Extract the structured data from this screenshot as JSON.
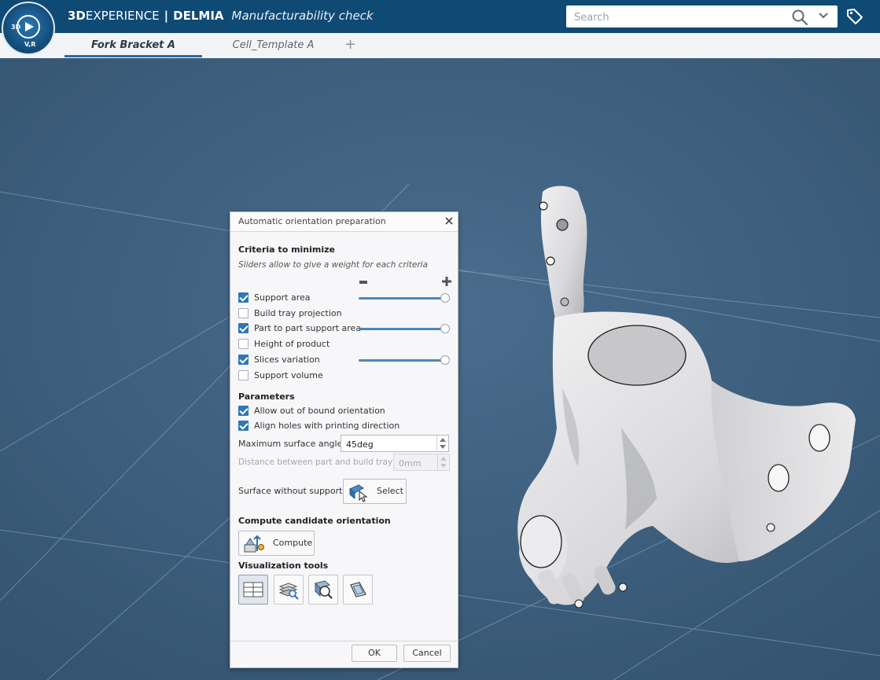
{
  "header": {
    "compass_labels": [
      "3D",
      "V,R"
    ],
    "brand_strong": "3D",
    "brand_light": "EXPERIENCE",
    "separator": "|",
    "brand_second": "DELMIA",
    "app_name": "Manufacturability check",
    "search_placeholder": "Search"
  },
  "tabs": [
    {
      "label": "Fork Bracket A",
      "active": true
    },
    {
      "label": "Cell_Template A",
      "active": false
    }
  ],
  "tab_add": "+",
  "dialog": {
    "title": "Automatic orientation preparation",
    "criteria_heading": "Criteria to minimize",
    "criteria_hint": "Sliders allow to give a weight for each criteria",
    "criteria": [
      {
        "label": "Support area",
        "checked": true,
        "weight": 1.0
      },
      {
        "label": "Build tray projection",
        "checked": false
      },
      {
        "label": "Part to part support area",
        "checked": true,
        "weight": 1.0
      },
      {
        "label": "Height of product",
        "checked": false
      },
      {
        "label": "Slices variation",
        "checked": true,
        "weight": 1.0
      },
      {
        "label": "Support volume",
        "checked": false
      }
    ],
    "parameters_heading": "Parameters",
    "params": [
      {
        "label": "Allow out of bound orientation",
        "checked": true
      },
      {
        "label": "Align holes with printing direction",
        "checked": true
      }
    ],
    "max_angle_label": "Maximum surface angle",
    "max_angle_value": "45deg",
    "distance_label": "Distance between part and build tray",
    "distance_value": "0mm",
    "surface_label": "Surface without support",
    "select_label": "Select",
    "compute_heading": "Compute candidate orientation",
    "compute_label": "Compute",
    "vis_heading": "Visualization tools",
    "ok_label": "OK",
    "cancel_label": "Cancel"
  },
  "colors": {
    "topbar": "#0f4a75",
    "viewport": "#3f6283",
    "accent": "#2f77b6"
  }
}
